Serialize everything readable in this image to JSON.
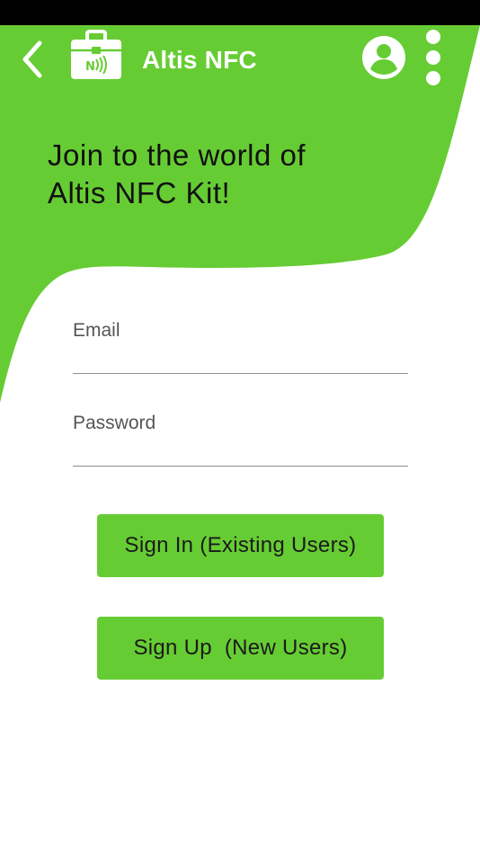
{
  "app": {
    "title": "Altis NFC",
    "headline": "Join to the world of\nAltis NFC Kit!",
    "accent_color": "#66cc33"
  },
  "icons": {
    "back": "chevron-left-icon",
    "logo": "nfc-toolbox-icon",
    "account": "account-circle-icon",
    "menu": "more-vertical-icon"
  },
  "form": {
    "email_label": "Email",
    "email_value": "",
    "password_label": "Password",
    "password_value": ""
  },
  "actions": {
    "sign_in_label": "Sign In (Existing Users)",
    "sign_up_label": "Sign Up  (New Users)"
  }
}
